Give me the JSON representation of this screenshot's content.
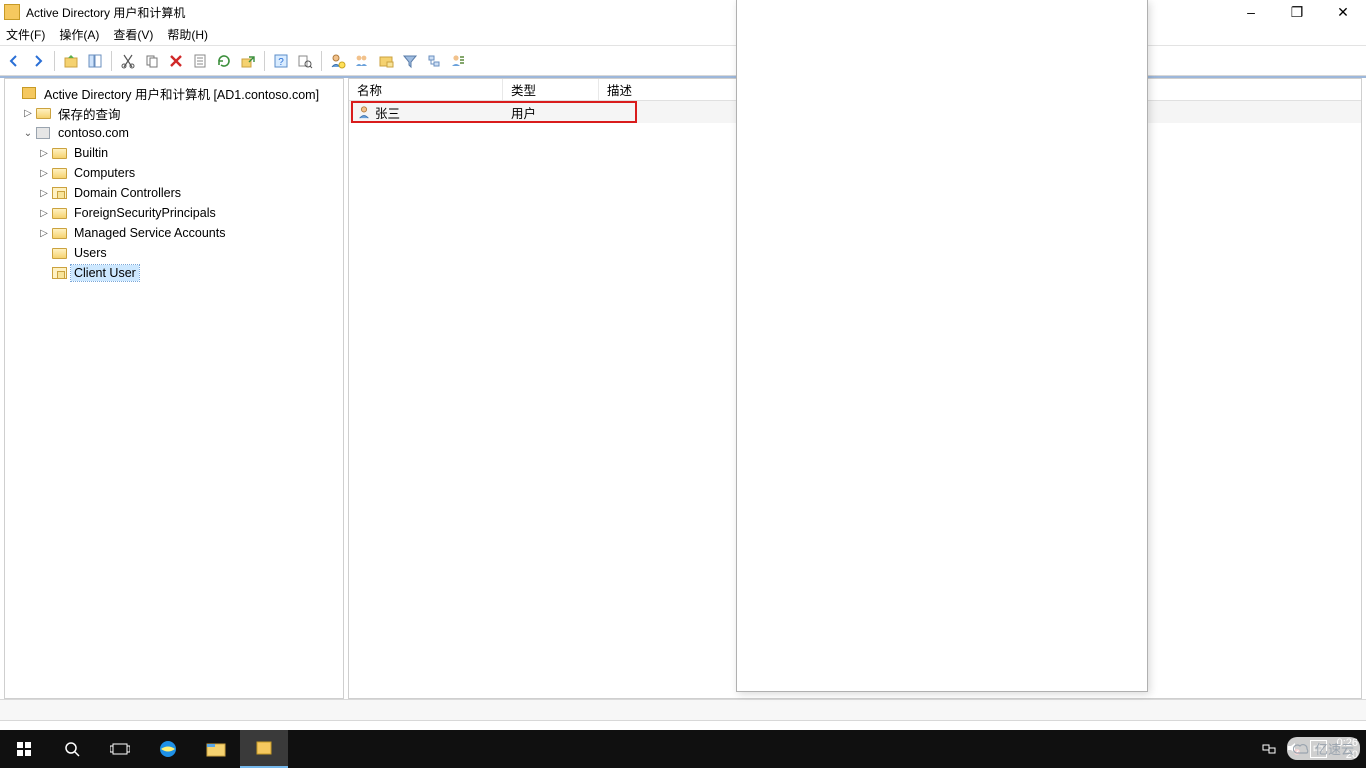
{
  "window": {
    "title": "Active Directory 用户和计算机",
    "minimize": "–",
    "maximize": "❐",
    "close": "✕"
  },
  "menu": {
    "file": "文件(F)",
    "action": "操作(A)",
    "view": "查看(V)",
    "help": "帮助(H)"
  },
  "toolbar_icons": {
    "back": "back-icon",
    "forward": "forward-icon",
    "up": "up-icon",
    "showhide": "showhide-icon",
    "cut": "cut-icon",
    "copy": "copy-icon",
    "delete": "delete-icon",
    "properties": "properties-icon",
    "refresh": "refresh-icon",
    "export": "export-icon",
    "help": "help-icon",
    "find": "find-icon",
    "newuser": "new-user-icon",
    "newgroup": "new-group-icon",
    "newou": "new-ou-icon",
    "filter": "filter-icon",
    "network": "network-icon",
    "misc": "misc-icon"
  },
  "tree": {
    "root": "Active Directory 用户和计算机 [AD1.contoso.com]",
    "saved_queries": "保存的查询",
    "domain": "contoso.com",
    "children": [
      {
        "label": "Builtin"
      },
      {
        "label": "Computers"
      },
      {
        "label": "Domain Controllers"
      },
      {
        "label": "ForeignSecurityPrincipals"
      },
      {
        "label": "Managed Service Accounts"
      },
      {
        "label": "Users"
      },
      {
        "label": "Client User"
      }
    ]
  },
  "list": {
    "headers": {
      "name": "名称",
      "type": "类型",
      "desc": "描述"
    },
    "rows": [
      {
        "name": "张三",
        "type": "用户",
        "desc": ""
      }
    ]
  },
  "taskbar": {
    "time": "0:26",
    "date_partial": "20",
    "ime": "中"
  },
  "watermark": "亿速云"
}
